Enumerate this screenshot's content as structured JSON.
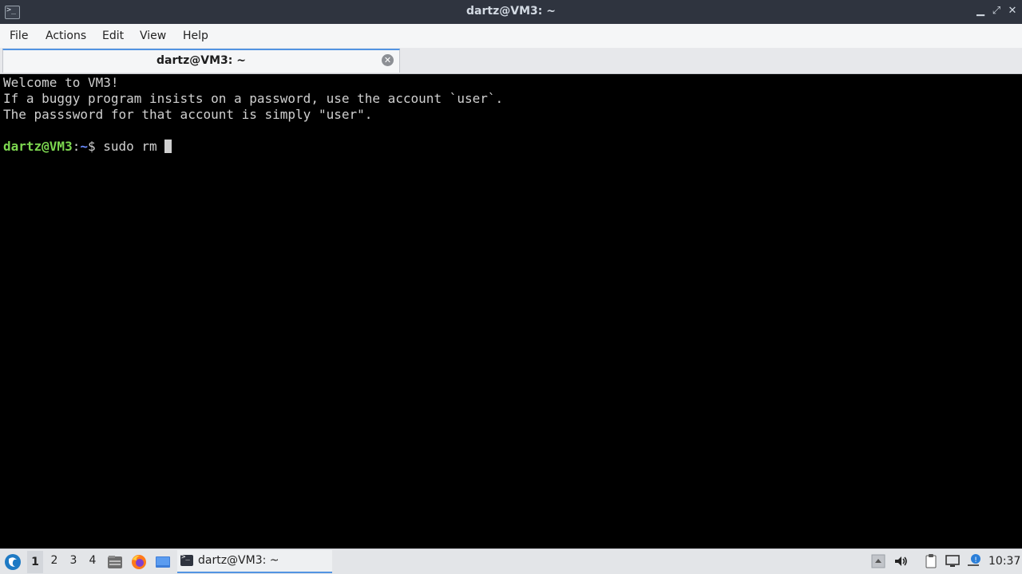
{
  "window": {
    "title": "dartz@VM3: ~",
    "minimize_glyph": "▁",
    "maximize_glyph": "⤢",
    "close_glyph": "✕"
  },
  "menu": {
    "file": "File",
    "actions": "Actions",
    "edit": "Edit",
    "view": "View",
    "help": "Help"
  },
  "tab": {
    "label": "dartz@VM3: ~",
    "close_glyph": "✕"
  },
  "terminal": {
    "lines": [
      "Welcome to VM3!",
      "If a buggy program insists on a password, use the account `user`.",
      "The passsword for that account is simply \"user\"."
    ],
    "prompt_user": "dartz@VM3",
    "prompt_colon": ":",
    "prompt_path": "~",
    "prompt_symbol": "$ ",
    "command": "sudo rm "
  },
  "taskbar": {
    "workspaces": [
      "1",
      "2",
      "3",
      "4"
    ],
    "active_workspace": "1",
    "task_label": "dartz@VM3: ~",
    "clock": "10:37"
  },
  "colors": {
    "titlebar": "#2f343f",
    "accent": "#5294e2",
    "prompt_user": "#7cd64f",
    "prompt_path": "#6b8cff"
  }
}
